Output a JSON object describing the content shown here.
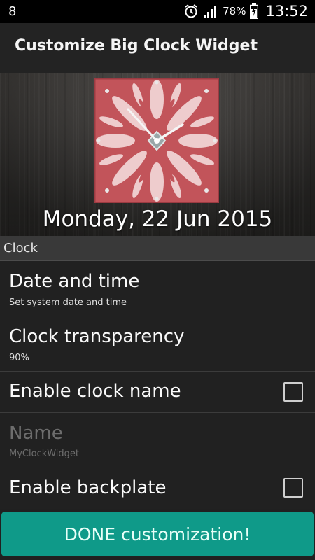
{
  "status_bar": {
    "left_icon": "notification-icon",
    "alarm_icon": "alarm-icon",
    "signal_icon": "signal-icon",
    "battery_percent": "78%",
    "battery_icon": "battery-charging-icon",
    "time": "13:52"
  },
  "app_bar": {
    "title": "Customize Big Clock Widget"
  },
  "preview": {
    "date": "Monday, 22 Jun 2015",
    "clock_face_color": "#c2545a"
  },
  "section": {
    "title": "Clock"
  },
  "items": [
    {
      "title": "Date and time",
      "subtitle": "Set system date and time"
    },
    {
      "title": "Clock transparency",
      "subtitle": "90%"
    },
    {
      "title": "Enable clock name",
      "checked": false
    },
    {
      "title": "Name",
      "subtitle": "MyClockWidget",
      "enabled": false
    },
    {
      "title": "Enable backplate",
      "checked": false
    }
  ],
  "done_button": {
    "label": "DONE customization!"
  },
  "colors": {
    "accent": "#0f9a89",
    "background": "#212121"
  }
}
